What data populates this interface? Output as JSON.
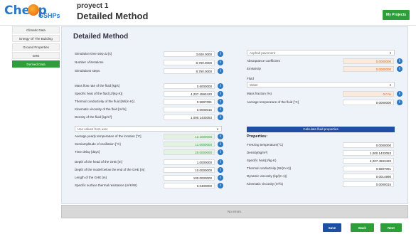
{
  "header": {
    "logo_text": "Cheap",
    "logo_sub": "GSHPs",
    "project_name": "proyect 1",
    "method_title": "Detailed Method",
    "my_projects_label": "My Projects"
  },
  "sidebar": {
    "items": [
      {
        "label": "Climatic Data"
      },
      {
        "label": "Energy Of The Building"
      },
      {
        "label": "Ground Properties"
      },
      {
        "label": "GHE"
      },
      {
        "label": "Derived Data"
      }
    ]
  },
  "main": {
    "title": "Detailed Method",
    "left_fields": [
      {
        "label": "Simulation time step Δt [s]",
        "value": "3,600.0000"
      },
      {
        "label": "Number of iterations",
        "value": "8,760.0000"
      },
      {
        "label": "Simulations steps",
        "value": "8,760.0000"
      },
      {
        "label": "Mass flow rate of the fluid [kg/s]",
        "value": "0.6000000"
      },
      {
        "label": "Specific heat of the fluid [J/(kg·K)]",
        "value": "4,207.4593420"
      },
      {
        "label": "Thermal conductivity of the fluid [W/(m·K)]",
        "value": "0.5887091"
      },
      {
        "label": "Kinematic viscosity of the fluid [m²/s]",
        "value": "0.0000015"
      },
      {
        "label": "Density of the fluid [kg/m³]",
        "value": "1,000.1433053"
      }
    ],
    "climate_select": "Use values from user",
    "climate_fields": [
      {
        "label": "Average yearly temperature of the location [°C]",
        "value": "12.1000000"
      },
      {
        "label": "Semiamplitude of oscillation [°C]",
        "value": "11.0000000"
      },
      {
        "label": "Time delay [days]",
        "value": "20.0000000"
      }
    ],
    "ghe_fields": [
      {
        "label": "Depth of the head of the GHE [m]",
        "value": "1.0000000"
      },
      {
        "label": "Depth of the model below the end of the GHE [m]",
        "value": "10.0000000"
      },
      {
        "label": "Length of the GHE [m]",
        "value": "100.0000000"
      },
      {
        "label": "Specific surface thermal resistance (m²K/W)",
        "value": "0.0400000"
      }
    ],
    "surface_select": "Asphalt pavement",
    "surface_fields": [
      {
        "label": "Absorptance coefficient",
        "value": "0.0000000"
      },
      {
        "label": "Emissivity",
        "value": "0.0000000"
      }
    ],
    "fluid_label": "Fluid",
    "fluid_select": "Water",
    "fluid_fields": [
      {
        "label": "Mass fraction (%)",
        "value": "0.0 %"
      },
      {
        "label": "Average temperature of the fluid [°C]",
        "value": "0.0000000"
      }
    ],
    "calc_button": "Calculate fluid properties",
    "properties_title": "Properties:",
    "properties": [
      {
        "label": "Freezing temperature(°C)",
        "value": "0.0000000"
      },
      {
        "label": "Density(kg/m³)",
        "value": "1,000.1433053"
      },
      {
        "label": "Specific heat(J/kg·K)",
        "value": "4,207.4593420"
      },
      {
        "label": "Thermal conductivity (W/(m·K))",
        "value": "0.5887091"
      },
      {
        "label": "Dynamic viscosity (kg/(m·s))",
        "value": "0.0014990"
      },
      {
        "label": "Kinematic viscosity (m²/s)",
        "value": "0.0000015"
      }
    ]
  },
  "status": {
    "message": "No errors."
  },
  "footer": {
    "save_label": "Save",
    "back_label": "Back",
    "next_label": "Next"
  },
  "colors": {
    "green": "#2e9e3a",
    "blue": "#1f4fa3",
    "accent_blue": "#2a78c6"
  }
}
